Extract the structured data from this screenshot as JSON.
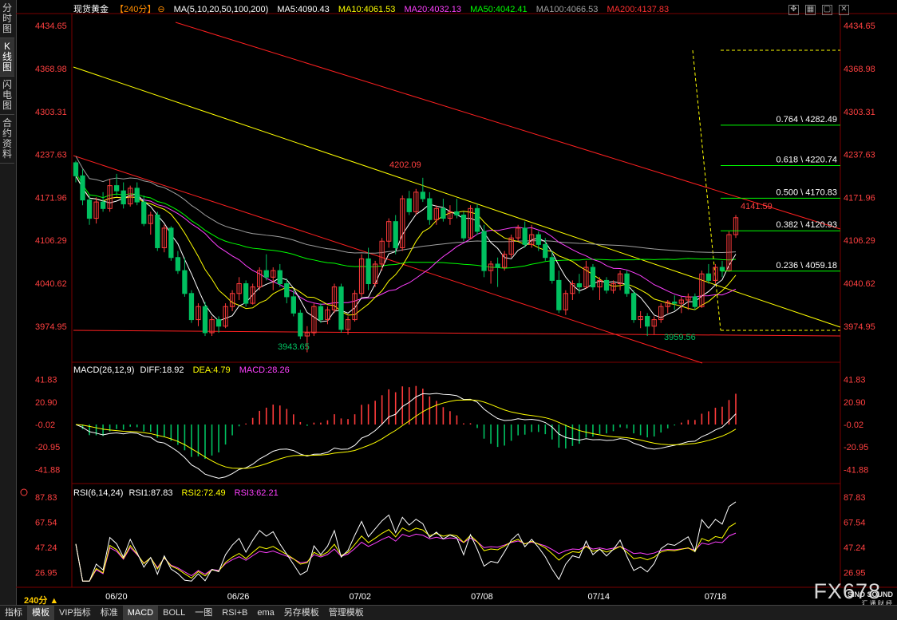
{
  "left_tabs": [
    "分时图",
    "K线图",
    "闪电图",
    "合约资料"
  ],
  "active_tab": 1,
  "header": {
    "symbol": "现货黄金",
    "period": "【240分】",
    "ma_label": "MA(5,10,20,50,100,200)",
    "ma5": "MA5:4090.43",
    "ma10": "MA10:4061.53",
    "ma20": "MA20:4032.13",
    "ma50": "MA50:4042.41",
    "ma100": "MA100:4066.53",
    "ma200": "MA200:4137.83"
  },
  "macd_header": {
    "label": "MACD(26,12,9)",
    "diff": "DIFF:18.92",
    "dea": "DEA:4.79",
    "macd": "MACD:28.26"
  },
  "rsi_header": {
    "label": "RSI(6,14,24)",
    "rsi1": "RSI1:87.83",
    "rsi2": "RSI2:72.49",
    "rsi3": "RSI3:62.21"
  },
  "period_label": "240分",
  "watermark": {
    "brand": "FX678",
    "sub1": "SINO SOUND",
    "sub2": "汇 通 财 经"
  },
  "status_bar": [
    "指标",
    "模板",
    "VIP指标",
    "标准",
    "MACD",
    "BOLL",
    "一图",
    "RSI+B",
    "ema",
    "另存模板",
    "管理模板"
  ],
  "status_selected": [
    1,
    4
  ],
  "colors": {
    "up": "#ff3b3b",
    "down": "#00c060",
    "ma5": "#ffffff",
    "ma10": "#ffff00",
    "ma20": "#ff40ff",
    "ma50": "#00ff00",
    "ma100": "#a0a0a0",
    "ma200": "#ff2020",
    "fib": "#00ff00",
    "trend_yellow": "#ffff00",
    "channel_red": "#ff2020"
  },
  "chart_data": {
    "type": "candlestick",
    "instrument": "现货黄金",
    "timeframe": "240分",
    "price_axis": {
      "ticks": [
        4434.65,
        4368.98,
        4303.31,
        4237.63,
        4171.96,
        4106.29,
        4040.62,
        3974.95
      ],
      "range": [
        3921,
        4452
      ]
    },
    "date_labels": [
      "06/20",
      "06/26",
      "07/02",
      "07/08",
      "07/14",
      "07/18"
    ],
    "annotations": [
      {
        "text": "4202.09",
        "price": 4202.09
      },
      {
        "text": "3943.65",
        "price": 3943.65
      },
      {
        "text": "3959.56",
        "price": 3959.56
      },
      {
        "text": "4141.59",
        "price": 4141.59
      }
    ],
    "fibonacci": [
      {
        "label": "0.764 \\ 4282.49",
        "price": 4282.49
      },
      {
        "label": "0.618 \\ 4220.74",
        "price": 4220.74
      },
      {
        "label": "0.500 \\ 4170.83",
        "price": 4170.83
      },
      {
        "label": "0.382 \\ 4120.93",
        "price": 4120.93
      },
      {
        "label": "0.236 \\ 4059.18",
        "price": 4059.18
      }
    ],
    "ohlc": [
      [
        4225,
        4228,
        4195,
        4205
      ],
      [
        4205,
        4215,
        4160,
        4168
      ],
      [
        4168,
        4175,
        4130,
        4140
      ],
      [
        4140,
        4172,
        4132,
        4165
      ],
      [
        4165,
        4180,
        4150,
        4155
      ],
      [
        4155,
        4200,
        4150,
        4190
      ],
      [
        4190,
        4208,
        4175,
        4182
      ],
      [
        4182,
        4195,
        4155,
        4162
      ],
      [
        4162,
        4190,
        4158,
        4186
      ],
      [
        4186,
        4195,
        4160,
        4165
      ],
      [
        4165,
        4175,
        4128,
        4132
      ],
      [
        4132,
        4150,
        4115,
        4145
      ],
      [
        4145,
        4150,
        4090,
        4095
      ],
      [
        4095,
        4130,
        4088,
        4125
      ],
      [
        4125,
        4128,
        4075,
        4080
      ],
      [
        4080,
        4090,
        4055,
        4060
      ],
      [
        4060,
        4080,
        4020,
        4025
      ],
      [
        4025,
        4030,
        3980,
        3985
      ],
      [
        3985,
        4010,
        3975,
        4005
      ],
      [
        4005,
        4012,
        3960,
        3965
      ],
      [
        3965,
        3990,
        3960,
        3985
      ],
      [
        3985,
        3990,
        3965,
        3975
      ],
      [
        3975,
        4010,
        3972,
        4005
      ],
      [
        4005,
        4030,
        3998,
        4025
      ],
      [
        4025,
        4050,
        4015,
        4040
      ],
      [
        4040,
        4045,
        4005,
        4010
      ],
      [
        4010,
        4040,
        4008,
        4035
      ],
      [
        4035,
        4065,
        4030,
        4060
      ],
      [
        4060,
        4085,
        4045,
        4050
      ],
      [
        4050,
        4065,
        4030,
        4060
      ],
      [
        4060,
        4070,
        4035,
        4040
      ],
      [
        4040,
        4048,
        4010,
        4020
      ],
      [
        4020,
        4030,
        3990,
        3995
      ],
      [
        3995,
        4000,
        3955,
        3960
      ],
      [
        3960,
        3975,
        3935,
        3965
      ],
      [
        3965,
        4010,
        3960,
        4005
      ],
      [
        4005,
        4010,
        3980,
        3985
      ],
      [
        3985,
        4005,
        3978,
        4000
      ],
      [
        4000,
        4040,
        3995,
        4035
      ],
      [
        4035,
        4040,
        3965,
        3970
      ],
      [
        3970,
        3990,
        3962,
        3985
      ],
      [
        3985,
        4030,
        3982,
        4025
      ],
      [
        4025,
        4085,
        4020,
        4078
      ],
      [
        4078,
        4095,
        4030,
        4040
      ],
      [
        4040,
        4075,
        4035,
        4070
      ],
      [
        4070,
        4110,
        4060,
        4105
      ],
      [
        4105,
        4140,
        4095,
        4135
      ],
      [
        4135,
        4145,
        4085,
        4095
      ],
      [
        4095,
        4175,
        4090,
        4170
      ],
      [
        4170,
        4182,
        4145,
        4150
      ],
      [
        4150,
        4185,
        4145,
        4180
      ],
      [
        4180,
        4202,
        4165,
        4170
      ],
      [
        4170,
        4180,
        4130,
        4138
      ],
      [
        4138,
        4160,
        4130,
        4155
      ],
      [
        4155,
        4170,
        4135,
        4140
      ],
      [
        4140,
        4160,
        4130,
        4150
      ],
      [
        4150,
        4170,
        4140,
        4145
      ],
      [
        4145,
        4150,
        4105,
        4110
      ],
      [
        4110,
        4160,
        4108,
        4155
      ],
      [
        4155,
        4162,
        4115,
        4120
      ],
      [
        4120,
        4130,
        4050,
        4060
      ],
      [
        4060,
        4075,
        4040,
        4070
      ],
      [
        4070,
        4080,
        4035,
        4065
      ],
      [
        4065,
        4090,
        4060,
        4085
      ],
      [
        4085,
        4115,
        4080,
        4110
      ],
      [
        4110,
        4130,
        4105,
        4125
      ],
      [
        4125,
        4135,
        4095,
        4100
      ],
      [
        4100,
        4130,
        4095,
        4115
      ],
      [
        4115,
        4120,
        4090,
        4100
      ],
      [
        4100,
        4110,
        4075,
        4080
      ],
      [
        4080,
        4090,
        4040,
        4045
      ],
      [
        4045,
        4060,
        3995,
        4000
      ],
      [
        4000,
        4030,
        3992,
        4025
      ],
      [
        4025,
        4045,
        4015,
        4040
      ],
      [
        4040,
        4055,
        4025,
        4035
      ],
      [
        4035,
        4075,
        4032,
        4065
      ],
      [
        4065,
        4070,
        4030,
        4035
      ],
      [
        4035,
        4050,
        4015,
        4045
      ],
      [
        4045,
        4050,
        4025,
        4030
      ],
      [
        4030,
        4045,
        4025,
        4040
      ],
      [
        4040,
        4060,
        4030,
        4055
      ],
      [
        4055,
        4060,
        4020,
        4025
      ],
      [
        4025,
        4030,
        3980,
        3985
      ],
      [
        3985,
        3998,
        3972,
        3990
      ],
      [
        3990,
        3995,
        3960,
        3975
      ],
      [
        3975,
        3990,
        3962,
        3985
      ],
      [
        3985,
        4010,
        3980,
        4005
      ],
      [
        4005,
        4015,
        3995,
        4012
      ],
      [
        4012,
        4022,
        4000,
        4010
      ],
      [
        4010,
        4020,
        3995,
        4015
      ],
      [
        4015,
        4025,
        4000,
        4020
      ],
      [
        4020,
        4025,
        4000,
        4005
      ],
      [
        4005,
        4060,
        4003,
        4055
      ],
      [
        4055,
        4070,
        4040,
        4045
      ],
      [
        4045,
        4070,
        4040,
        4065
      ],
      [
        4065,
        4075,
        4050,
        4060
      ],
      [
        4060,
        4120,
        4058,
        4115
      ],
      [
        4115,
        4145,
        4110,
        4141
      ]
    ],
    "ma_values": {
      "MA5": 4090.43,
      "MA10": 4061.53,
      "MA20": 4032.13,
      "MA50": 4042.41,
      "MA100": 4066.53,
      "MA200": 4137.83
    },
    "macd": {
      "params": "26,12,9",
      "DIFF": 18.92,
      "DEA": 4.79,
      "MACD": 28.26,
      "axis_ticks": [
        41.83,
        20.9,
        -0.02,
        -20.95,
        -41.88
      ]
    },
    "rsi": {
      "params": "6,14,24",
      "RSI1": 87.83,
      "RSI2": 72.49,
      "RSI3": 62.21,
      "axis_ticks": [
        87.83,
        67.54,
        47.24,
        26.95
      ]
    }
  }
}
